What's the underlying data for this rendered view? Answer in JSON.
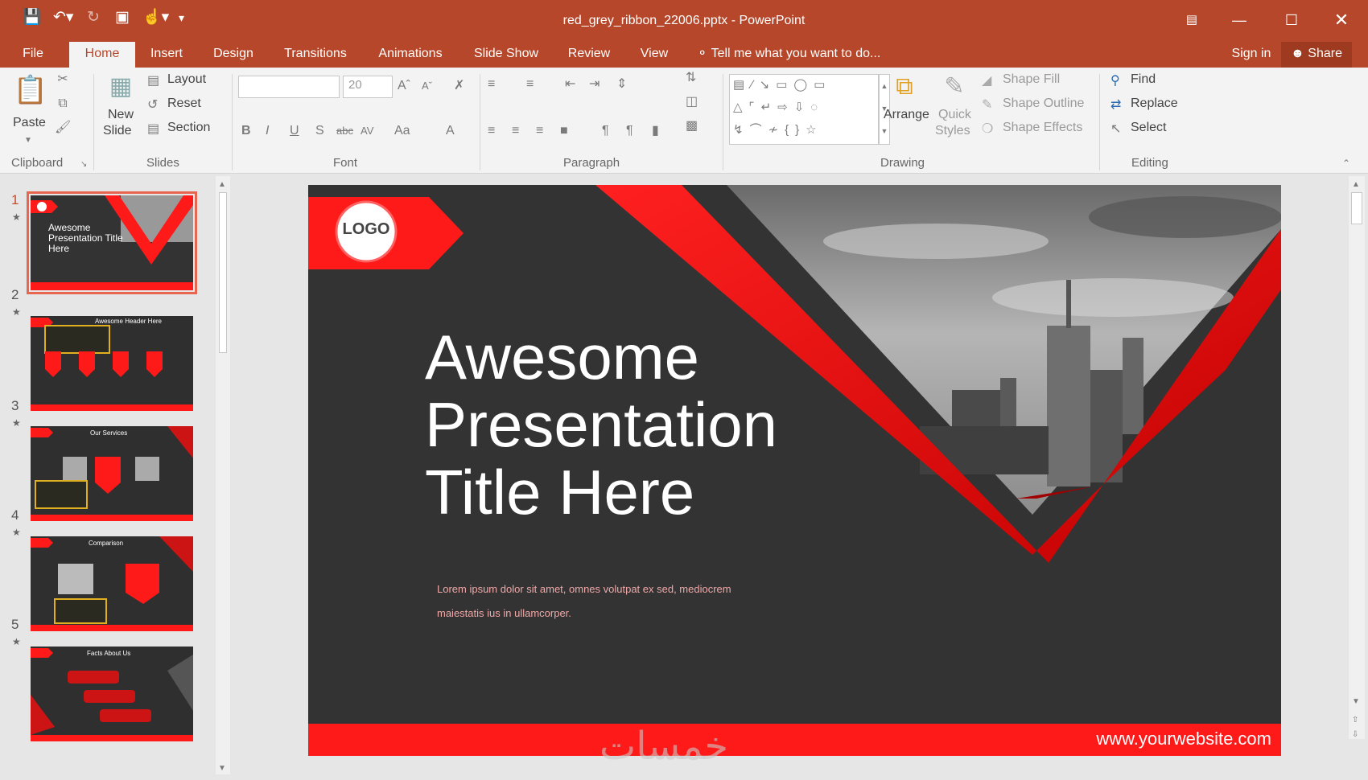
{
  "window": {
    "title": "red_grey_ribbon_22006.pptx - PowerPoint",
    "sign_in": "Sign in",
    "share": "Share"
  },
  "tabs": [
    "File",
    "Home",
    "Insert",
    "Design",
    "Transitions",
    "Animations",
    "Slide Show",
    "Review",
    "View"
  ],
  "tell_me": "Tell me what you want to do...",
  "ribbon": {
    "clipboard": {
      "label": "Clipboard",
      "paste": "Paste"
    },
    "slides": {
      "label": "Slides",
      "new_slide_1": "New",
      "new_slide_2": "Slide",
      "layout": "Layout",
      "reset": "Reset",
      "section": "Section"
    },
    "font": {
      "label": "Font",
      "font_name": "",
      "font_size": "20"
    },
    "paragraph": {
      "label": "Paragraph"
    },
    "drawing": {
      "label": "Drawing",
      "arrange": "Arrange",
      "quick_styles_1": "Quick",
      "quick_styles_2": "Styles",
      "shape_fill": "Shape Fill",
      "shape_outline": "Shape Outline",
      "shape_effects": "Shape Effects"
    },
    "editing": {
      "label": "Editing",
      "find": "Find",
      "replace": "Replace",
      "select": "Select"
    }
  },
  "thumbnails": [
    {
      "num": "1",
      "text": "Awesome Presentation Title Here",
      "selected": true
    },
    {
      "num": "2",
      "text": "Awesome Header Here",
      "selected": false
    },
    {
      "num": "3",
      "text": "Our Services",
      "selected": false
    },
    {
      "num": "4",
      "text": "Comparison",
      "selected": false
    },
    {
      "num": "5",
      "text": "Facts About Us",
      "selected": false
    }
  ],
  "slide": {
    "logo": "LOGO",
    "title_line1": "Awesome",
    "title_line2": "Presentation",
    "title_line3": "Title Here",
    "body_line1": "Lorem ipsum dolor sit amet, omnes volutpat ex sed, mediocrem",
    "body_line2": "maiestatis ius in ullamcorper.",
    "website": "www.yourwebsite.com"
  },
  "watermark": "خمسات",
  "colors": {
    "accent": "#b7472a",
    "slide_red": "#ff1a1a",
    "slide_bg": "#333333"
  }
}
